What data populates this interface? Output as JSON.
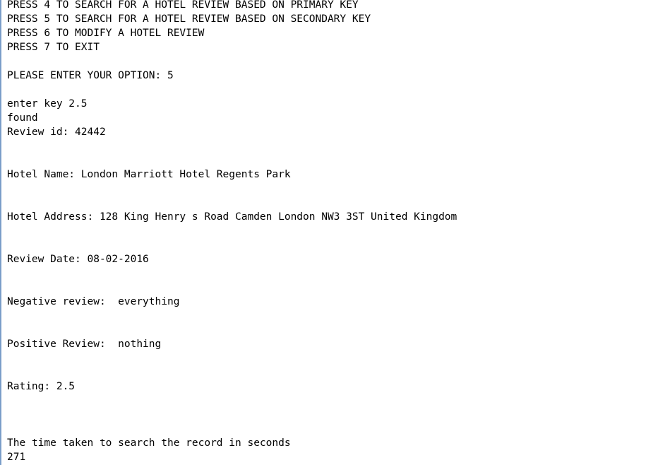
{
  "console": {
    "lines": [
      "PRESS 4 TO SEARCH FOR A HOTEL REVIEW BASED ON PRIMARY KEY",
      "PRESS 5 TO SEARCH FOR A HOTEL REVIEW BASED ON SECONDARY KEY",
      "PRESS 6 TO MODIFY A HOTEL REVIEW",
      "PRESS 7 TO EXIT",
      "",
      "PLEASE ENTER YOUR OPTION: 5",
      "",
      "enter key 2.5",
      "found",
      "Review id: 42442",
      "",
      "",
      "Hotel Name: London Marriott Hotel Regents Park",
      "",
      "",
      "Hotel Address: 128 King Henry s Road Camden London NW3 3ST United Kingdom",
      "",
      "",
      "Review Date: 08-02-2016",
      "",
      "",
      "Negative review:  everything",
      "",
      "",
      "Positive Review:  nothing",
      "",
      "",
      "Rating: 2.5",
      "",
      "",
      "",
      "The time taken to search the record in seconds",
      "271"
    ]
  }
}
